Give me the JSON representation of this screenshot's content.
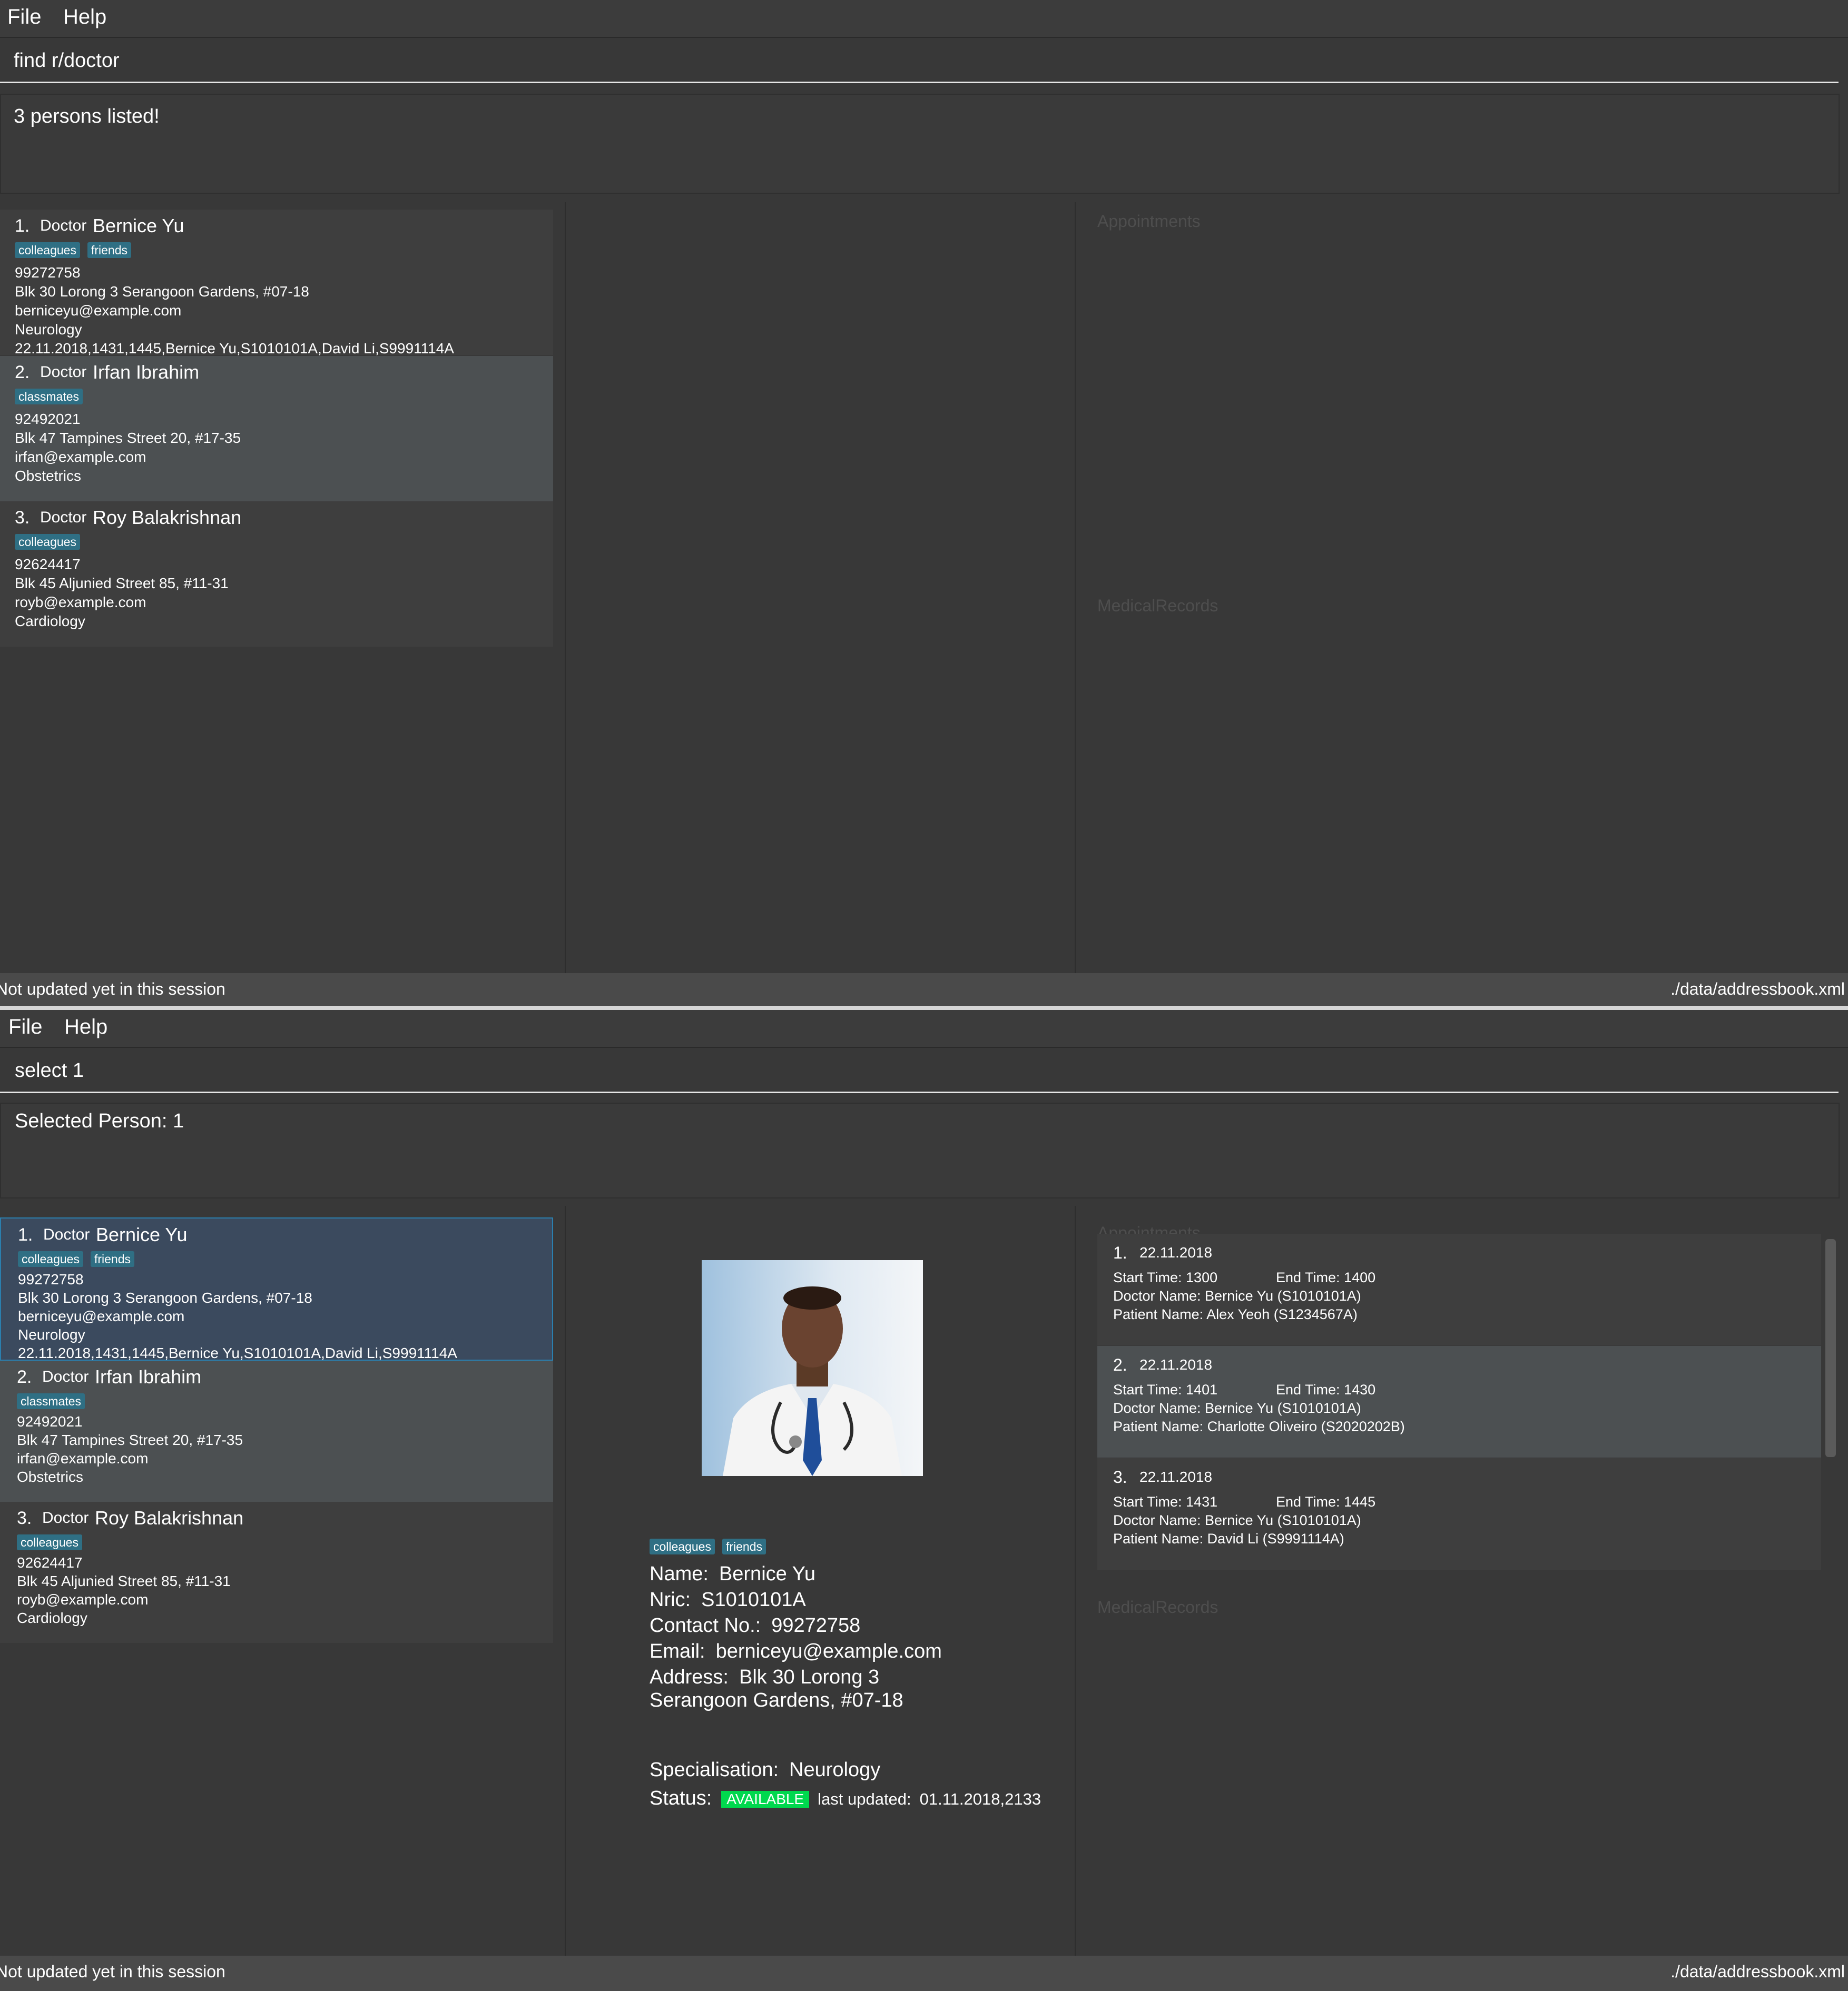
{
  "menu": {
    "file": "File",
    "help": "Help"
  },
  "top": {
    "command": "find r/doctor",
    "result": "3 persons listed!",
    "section_appointments": "Appointments",
    "section_medical": "MedicalRecords",
    "status_left": "Not updated yet in this session",
    "status_right": "./data/addressbook.xml"
  },
  "bottom": {
    "command": "select 1",
    "result": "Selected Person: 1",
    "section_appointments": "Appointments",
    "section_medical": "MedicalRecords",
    "status_left": "Not updated yet in this session",
    "status_right": "./data/addressbook.xml"
  },
  "persons": [
    {
      "index": "1.",
      "role": "Doctor",
      "name": "Bernice Yu",
      "tags": [
        "colleagues",
        "friends"
      ],
      "phone": "99272758",
      "address": "Blk 30 Lorong 3 Serangoon Gardens, #07-18",
      "email": "berniceyu@example.com",
      "specialisation": "Neurology",
      "appointment": "22.11.2018,1431,1445,Bernice Yu,S1010101A,David Li,S9991114A"
    },
    {
      "index": "2.",
      "role": "Doctor",
      "name": "Irfan Ibrahim",
      "tags": [
        "classmates"
      ],
      "phone": "92492021",
      "address": "Blk 47 Tampines Street 20, #17-35",
      "email": "irfan@example.com",
      "specialisation": "Obstetrics",
      "appointment": ""
    },
    {
      "index": "3.",
      "role": "Doctor",
      "name": "Roy Balakrishnan",
      "tags": [
        "colleagues"
      ],
      "phone": "92624417",
      "address": "Blk 45 Aljunied Street 85, #11-31",
      "email": "royb@example.com",
      "specialisation": "Cardiology",
      "appointment": ""
    }
  ],
  "detail": {
    "tags": [
      "colleagues",
      "friends"
    ],
    "name_label": "Name:",
    "name": "Bernice Yu",
    "nric_label": "Nric:",
    "nric": "S1010101A",
    "contact_label": "Contact No.:",
    "contact": "99272758",
    "email_label": "Email:",
    "email": "berniceyu@example.com",
    "address_label": "Address:",
    "address_line1": "Blk 30 Lorong 3",
    "address_line2": "Serangoon Gardens, #07-18",
    "spec_label": "Specialisation:",
    "spec": "Neurology",
    "status_label": "Status:",
    "status": "AVAILABLE",
    "updated_label": "last updated:",
    "updated": "01.11.2018,2133"
  },
  "appointments": [
    {
      "index": "1.",
      "date": "22.11.2018",
      "start": "Start Time: 1300",
      "end": "End Time: 1400",
      "doctor": "Doctor Name: Bernice Yu (S1010101A)",
      "patient": "Patient Name: Alex Yeoh (S1234567A)"
    },
    {
      "index": "2.",
      "date": "22.11.2018",
      "start": "Start Time: 1401",
      "end": "End Time: 1430",
      "doctor": "Doctor Name: Bernice Yu (S1010101A)",
      "patient": "Patient Name: Charlotte Oliveiro (S2020202B)"
    },
    {
      "index": "3.",
      "date": "22.11.2018",
      "start": "Start Time: 1431",
      "end": "End Time: 1445",
      "doctor": "Doctor Name: Bernice Yu (S1010101A)",
      "patient": "Patient Name: David Li (S9991114A)"
    }
  ],
  "colors": {
    "tag": "#2f6f84",
    "available": "#00d84e",
    "selection": "#3b4a5e",
    "selection_border": "#2b7fae"
  },
  "icons": {
    "photo": "doctor-portrait"
  }
}
